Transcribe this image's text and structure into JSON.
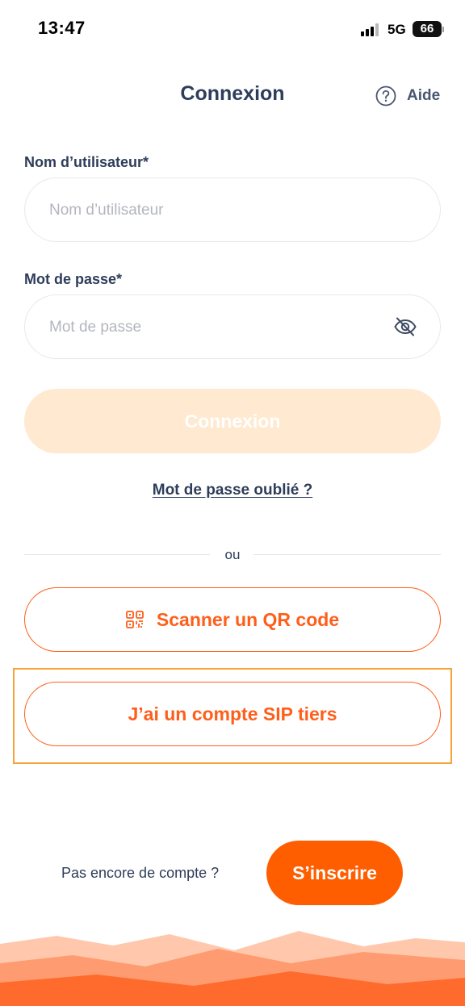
{
  "status_bar": {
    "time": "13:47",
    "network": "5G",
    "battery": "66"
  },
  "header": {
    "title": "Connexion",
    "help_label": "Aide",
    "help_icon": "question-circle-icon"
  },
  "form": {
    "username": {
      "label": "Nom d’utilisateur*",
      "placeholder": "Nom d’utilisateur",
      "value": ""
    },
    "password": {
      "label": "Mot de passe*",
      "placeholder": "Mot de passe",
      "value": "",
      "toggle_icon": "eye-slash-icon"
    },
    "submit_label": "Connexion",
    "forgot_label": "Mot de passe oublié ?"
  },
  "divider": {
    "label": "ou"
  },
  "alternatives": {
    "scan_qr_label": "Scanner un QR code",
    "scan_qr_icon": "qr-code-icon",
    "sip_account_label": "J’ai un compte SIP tiers"
  },
  "signup": {
    "prompt": "Pas encore de compte ?",
    "button_label": "S’inscrire"
  },
  "colors": {
    "primary_orange": "#ff5e00",
    "disabled_button": "#ffe9d1",
    "text_navy": "#2e3d5a",
    "highlight_border": "#f5a339"
  }
}
